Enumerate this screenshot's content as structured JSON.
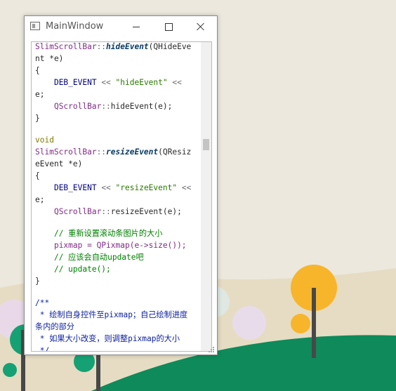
{
  "window": {
    "title": "MainWindow",
    "minimize_icon": "minimize-icon",
    "maximize_icon": "maximize-icon",
    "close_icon": "close-icon"
  },
  "editor": {
    "lines": {
      "l1": {
        "cls": "SlimScrollBar",
        "op": "::",
        "fn": "hideEvent",
        "rest": "(QHideEve"
      },
      "l2": {
        "text": "nt *e)"
      },
      "l3": {
        "text": "{"
      },
      "l4": {
        "mac": "DEB_EVENT",
        "op": " << ",
        "str": "\"hideEvent\"",
        "op2": " <<"
      },
      "l5": {
        "text": "e;"
      },
      "l6": {
        "cls": "QScrollBar",
        "op": "::",
        "rest": "hideEvent(e);"
      },
      "l7": {
        "text": "}"
      },
      "l8": {
        "kw": "void"
      },
      "l9": {
        "cls": "SlimScrollBar",
        "op": "::",
        "fn": "resizeEvent",
        "rest": "(QResiz"
      },
      "l10": {
        "text": "eEvent *e)"
      },
      "l11": {
        "text": "{"
      },
      "l12": {
        "mac": "DEB_EVENT",
        "op": " << ",
        "str": "\"resizeEvent\"",
        "op2": " <<"
      },
      "l13": {
        "text": "e;"
      },
      "l14": {
        "cls": "QScrollBar",
        "op": "::",
        "rest": "resizeEvent(e);"
      },
      "l15": {
        "cmt": "// 重新设置滚动条图片的大小"
      },
      "l16": {
        "text": "pixmap = QPixmap(e->size());"
      },
      "l17": {
        "cmt": "// 应该会自动update吧"
      },
      "l18": {
        "cmt": "// update();"
      },
      "l19": {
        "text": "}"
      },
      "l20": {
        "doc": "/**"
      },
      "l21": {
        "doc": " * 绘制自身控件至pixmap；自己绘制进度"
      },
      "l22": {
        "doc": "条内的部分"
      },
      "l23": {
        "doc": " * 如果大小改变，则调整pixmap的大小"
      },
      "l24": {
        "doc": " */"
      }
    }
  }
}
